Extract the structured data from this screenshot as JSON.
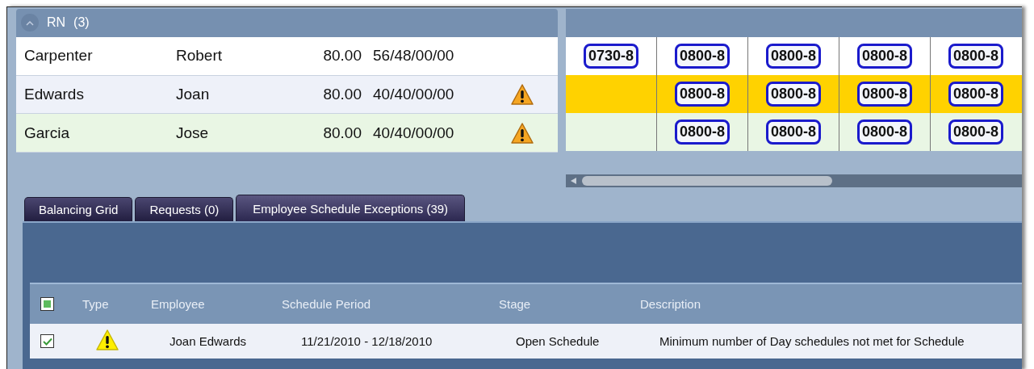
{
  "group": {
    "title": "RN",
    "count": "(3)",
    "expanded": true
  },
  "employees": [
    {
      "last_name": "Carpenter",
      "first_name": "Robert",
      "hours": "80.00",
      "pattern": "56/48/00/00",
      "warning": false,
      "color": "#ffffff",
      "highlighted": false,
      "cells": [
        {
          "kind": "shift",
          "text": "0730-8"
        },
        {
          "kind": "shift",
          "text": "0800-8"
        },
        {
          "kind": "shift",
          "text": "0800-8"
        },
        {
          "kind": "shift",
          "text": "0800-8"
        },
        {
          "kind": "shift",
          "text": "0800-8"
        }
      ]
    },
    {
      "last_name": "Edwards",
      "first_name": "Joan",
      "hours": "80.00",
      "pattern": "40/40/00/00",
      "warning": true,
      "color": "#eef1f9",
      "highlighted": true,
      "cells": [
        {
          "kind": "empty"
        },
        {
          "kind": "shift",
          "text": "0800-8"
        },
        {
          "kind": "shift",
          "text": "0800-8"
        },
        {
          "kind": "shift",
          "text": "0800-8"
        },
        {
          "kind": "shift",
          "text": "0800-8"
        }
      ]
    },
    {
      "last_name": "Garcia",
      "first_name": "Jose",
      "hours": "80.00",
      "pattern": "40/40/00/00",
      "warning": true,
      "color": "#e9f6e4",
      "highlighted": false,
      "cells": [
        {
          "kind": "empty"
        },
        {
          "kind": "shift",
          "text": "0800-8"
        },
        {
          "kind": "shift",
          "text": "0800-8"
        },
        {
          "kind": "shift",
          "text": "0800-8"
        },
        {
          "kind": "shift",
          "text": "0800-8"
        }
      ]
    }
  ],
  "tabs": [
    {
      "label": "Balancing Grid",
      "selected": false
    },
    {
      "label": "Requests (0)",
      "selected": false
    },
    {
      "label": "Employee Schedule Exceptions (39)",
      "selected": true
    }
  ],
  "exceptions": {
    "select_all_checked": true,
    "columns": [
      "Type",
      "Employee",
      "Schedule Period",
      "Stage",
      "Description"
    ],
    "rows": [
      {
        "checked": true,
        "warning": true,
        "employee": "Joan Edwards",
        "schedule_period": "11/21/2010 - 12/18/2010",
        "stage": "Open Schedule",
        "description": "Minimum number of Day schedules not met for Schedule"
      }
    ]
  }
}
